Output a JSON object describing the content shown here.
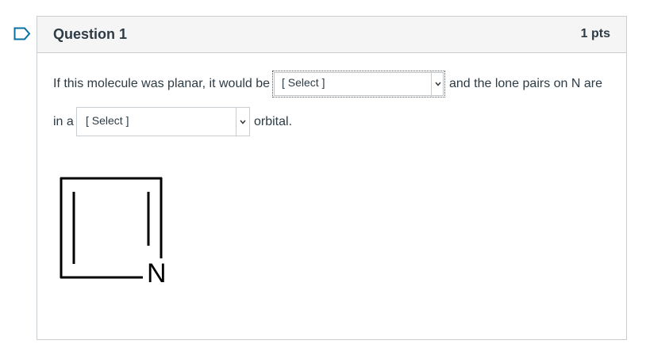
{
  "flag": {
    "icon": "bookmark-flag-icon"
  },
  "question": {
    "title": "Question 1",
    "points": "1 pts",
    "text": {
      "part1": "If this molecule was planar, it would be",
      "part2": "and the lone pairs on N are",
      "part3": "in a",
      "part4": "orbital."
    },
    "dropdown1": {
      "selected": "[ Select ]"
    },
    "dropdown2": {
      "selected": "[ Select ]"
    },
    "molecule": {
      "atom_label": "N"
    }
  },
  "colors": {
    "text": "#2d3b45",
    "border": "#c7cdd1",
    "header_bg": "#f5f5f5",
    "flag": "#0770a3"
  }
}
